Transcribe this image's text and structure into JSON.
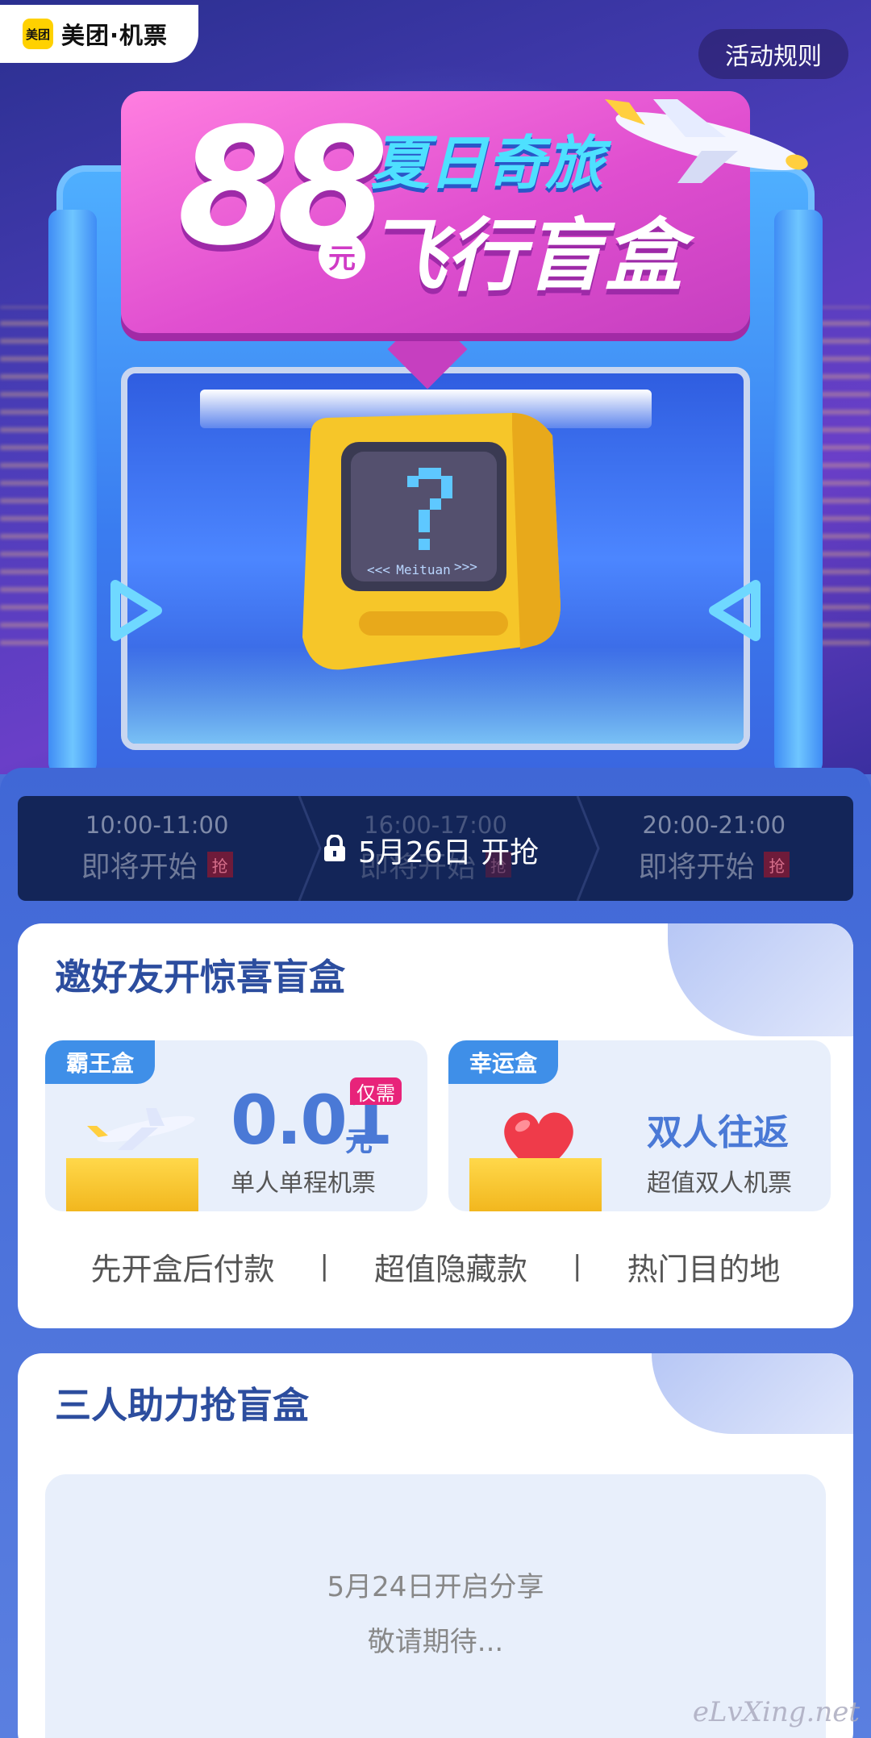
{
  "header": {
    "brand_logo": "美团",
    "brand_name": "美团·机票",
    "rules_button": "活动规则"
  },
  "banner": {
    "price_number": "88",
    "price_unit": "元",
    "title_line1": "夏日奇旅",
    "title_line2": "飞行盲盒"
  },
  "mystery_box": {
    "screen_text": "Meituan"
  },
  "time_slots": [
    {
      "time": "10:00-11:00",
      "status": "即将开始",
      "badge": "抢"
    },
    {
      "time": "16:00-17:00",
      "status": "即将开始",
      "badge": "抢"
    },
    {
      "time": "20:00-21:00",
      "status": "即将开始",
      "badge": "抢"
    }
  ],
  "active_slot_notice": "5月26日 开抢",
  "invite_card": {
    "title": "邀好友开惊喜盲盒",
    "offers": [
      {
        "tag": "霸王盒",
        "price": "0.01",
        "unit": "元",
        "only_label": "仅需",
        "subtitle": "单人单程机票"
      },
      {
        "tag": "幸运盒",
        "headline": "双人往返",
        "subtitle": "超值双人机票"
      }
    ],
    "features": [
      "先开盒后付款",
      "超值隐藏款",
      "热门目的地"
    ],
    "separator": "|"
  },
  "assist_card": {
    "title": "三人助力抢盲盒",
    "line1": "5月24日开启分享",
    "line2": "敬请期待..."
  },
  "watermark": "eLvXing.net",
  "colors": {
    "accent": "#3f8fe8",
    "banner_pink": "#e04fd0",
    "title_blue": "#2c4d9e",
    "slot_bg": "#132558"
  }
}
